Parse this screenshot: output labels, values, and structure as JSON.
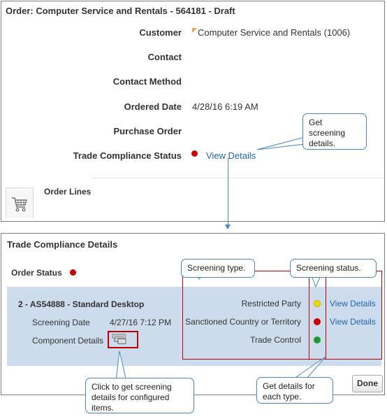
{
  "order": {
    "title": "Order: Computer Service and Rentals - 564181 - Draft",
    "fields": {
      "customer_label": "Customer",
      "customer_value": "Computer Service and Rentals (1006)",
      "contact_label": "Contact",
      "contact_method_label": "Contact Method",
      "ordered_date_label": "Ordered Date",
      "ordered_date_value": "4/28/16 6:19 AM",
      "purchase_order_label": "Purchase Order",
      "trade_compliance_label": "Trade Compliance Status",
      "view_details_link": "View Details"
    },
    "order_lines_label": "Order Lines",
    "status_color": "#cc0000"
  },
  "trade_compliance": {
    "title": "Trade Compliance Details",
    "order_status_label": "Order Status",
    "line_title": "2 - AS54888 - Standard Desktop",
    "screening_date_label": "Screening Date",
    "screening_date_value": "4/27/16 7:12 PM",
    "component_details_label": "Component Details",
    "screenings": [
      {
        "type": "Restricted Party",
        "status_color": "#f2d600",
        "link": "View Details"
      },
      {
        "type": "Sanctioned Country or Territory",
        "status_color": "#cc0000",
        "link": "View Details"
      },
      {
        "type": "Trade Control",
        "status_color": "#1a9a2a",
        "link": ""
      }
    ],
    "done_label": "Done"
  },
  "callouts": {
    "get_screening": "Get screening details.",
    "screening_type": "Screening type.",
    "screening_status": "Screening status.",
    "click_configured": "Click to get screening details for configured items.",
    "get_details_each": "Get details for each type."
  },
  "icons": {
    "cart": "cart-icon",
    "component": "component-details-icon"
  }
}
